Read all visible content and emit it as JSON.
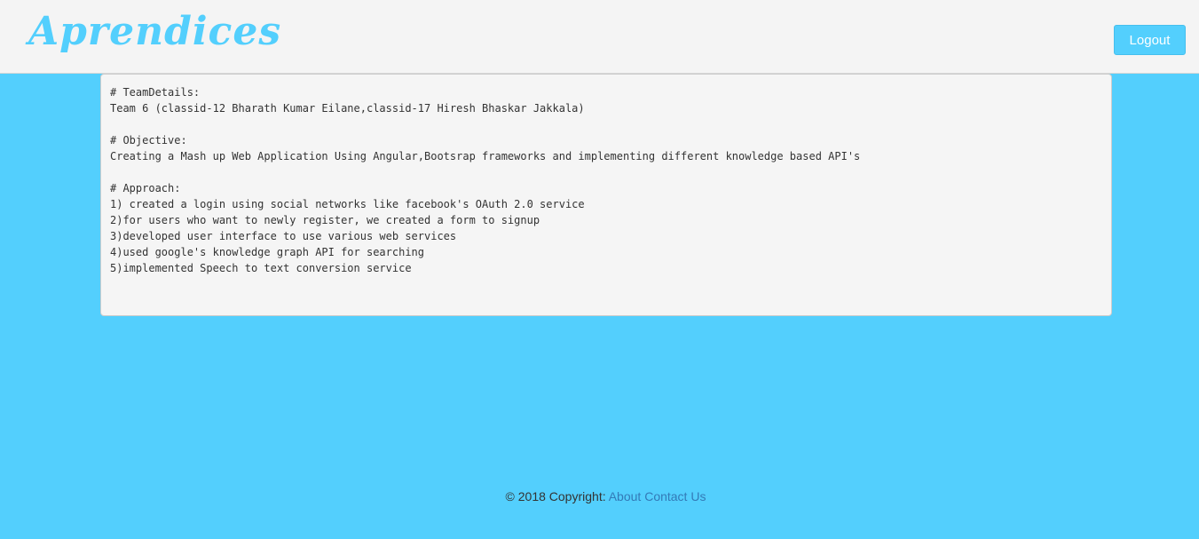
{
  "navbar": {
    "brand": "Aprendices",
    "logout_label": "Logout"
  },
  "readme": {
    "text": "# TeamDetails:\nTeam 6 (classid-12 Bharath Kumar Eilane,classid-17 Hiresh Bhaskar Jakkala)\n\n# Objective:\nCreating a Mash up Web Application Using Angular,Bootsrap frameworks and implementing different knowledge based API's\n\n# Approach:\n1) created a login using social networks like facebook's OAuth 2.0 service\n2)for users who want to newly register, we created a form to signup\n3)developed user interface to use various web services\n4)used google's knowledge graph API for searching\n5)implemented Speech to text conversion service"
  },
  "footer": {
    "copyright": "© 2018 Copyright:",
    "about_label": "About",
    "contact_label": "Contact Us"
  },
  "colors": {
    "background": "#53cffd",
    "navbar": "#f4f4f4",
    "brand": "#53cffd",
    "link": "#337ab7"
  }
}
